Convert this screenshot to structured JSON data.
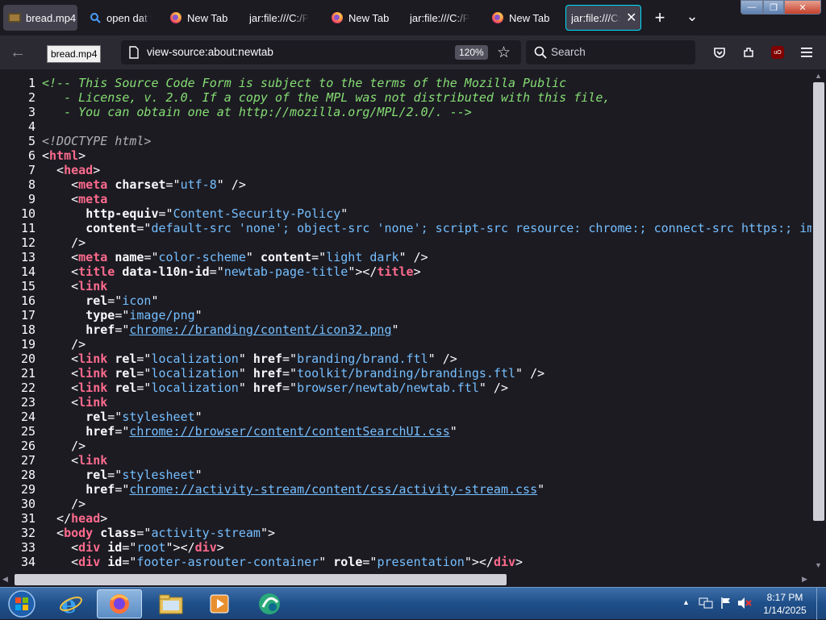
{
  "tabs": [
    {
      "label": "bread.mp4",
      "icon": "video-icon"
    },
    {
      "label": "open dat f",
      "icon": "search-icon"
    },
    {
      "label": "New Tab",
      "icon": "firefox-icon"
    },
    {
      "label": "jar:file:///C:/P",
      "icon": "none"
    },
    {
      "label": "New Tab",
      "icon": "firefox-icon"
    },
    {
      "label": "jar:file:///C:/P",
      "icon": "none"
    },
    {
      "label": "New Tab",
      "icon": "firefox-icon"
    },
    {
      "label": "jar:file:///C:",
      "icon": "none",
      "selected": true
    }
  ],
  "new_tab_symbol": "+",
  "tab_list_symbol": "⌄",
  "window_controls": {
    "minimize": "—",
    "restore": "❐",
    "close": "✕"
  },
  "nav": {
    "back_symbol": "←",
    "tooltip": "bread.mp4",
    "url": "view-source:about:newtab",
    "zoom": "120%",
    "search_placeholder": "Search"
  },
  "source_lines": [
    {
      "n": "1",
      "segs": [
        {
          "c": "c",
          "t": "<!-- This Source Code Form is subject to the terms of the Mozilla Public"
        }
      ]
    },
    {
      "n": "2",
      "segs": [
        {
          "c": "c",
          "t": "   - License, v. 2.0. If a copy of the MPL was not distributed with this file,"
        }
      ]
    },
    {
      "n": "3",
      "segs": [
        {
          "c": "c",
          "t": "   - You can obtain one at http://mozilla.org/MPL/2.0/. -->"
        }
      ]
    },
    {
      "n": "4",
      "segs": []
    },
    {
      "n": "5",
      "segs": [
        {
          "c": "dt",
          "t": "<!DOCTYPE html>"
        }
      ]
    },
    {
      "n": "6",
      "segs": [
        {
          "c": "p",
          "t": "<"
        },
        {
          "c": "tn",
          "t": "html"
        },
        {
          "c": "p",
          "t": ">"
        }
      ]
    },
    {
      "n": "7",
      "segs": [
        {
          "c": "p",
          "t": "  <"
        },
        {
          "c": "tn",
          "t": "head"
        },
        {
          "c": "p",
          "t": ">"
        }
      ]
    },
    {
      "n": "8",
      "segs": [
        {
          "c": "p",
          "t": "    <"
        },
        {
          "c": "tn",
          "t": "meta"
        },
        {
          "c": "p",
          "t": " "
        },
        {
          "c": "a",
          "t": "charset"
        },
        {
          "c": "p",
          "t": "=\""
        },
        {
          "c": "v",
          "t": "utf-8"
        },
        {
          "c": "p",
          "t": "\" />"
        }
      ]
    },
    {
      "n": "9",
      "segs": [
        {
          "c": "p",
          "t": "    <"
        },
        {
          "c": "tn",
          "t": "meta"
        }
      ]
    },
    {
      "n": "10",
      "segs": [
        {
          "c": "p",
          "t": "      "
        },
        {
          "c": "a",
          "t": "http-equiv"
        },
        {
          "c": "p",
          "t": "=\""
        },
        {
          "c": "v",
          "t": "Content-Security-Policy"
        },
        {
          "c": "p",
          "t": "\""
        }
      ]
    },
    {
      "n": "11",
      "segs": [
        {
          "c": "p",
          "t": "      "
        },
        {
          "c": "a",
          "t": "content"
        },
        {
          "c": "p",
          "t": "=\""
        },
        {
          "c": "v",
          "t": "default-src 'none'; object-src 'none'; script-src resource: chrome:; connect-src https:; img-src"
        }
      ]
    },
    {
      "n": "12",
      "segs": [
        {
          "c": "p",
          "t": "    />"
        }
      ]
    },
    {
      "n": "13",
      "segs": [
        {
          "c": "p",
          "t": "    <"
        },
        {
          "c": "tn",
          "t": "meta"
        },
        {
          "c": "p",
          "t": " "
        },
        {
          "c": "a",
          "t": "name"
        },
        {
          "c": "p",
          "t": "=\""
        },
        {
          "c": "v",
          "t": "color-scheme"
        },
        {
          "c": "p",
          "t": "\" "
        },
        {
          "c": "a",
          "t": "content"
        },
        {
          "c": "p",
          "t": "=\""
        },
        {
          "c": "v",
          "t": "light dark"
        },
        {
          "c": "p",
          "t": "\" />"
        }
      ]
    },
    {
      "n": "14",
      "segs": [
        {
          "c": "p",
          "t": "    <"
        },
        {
          "c": "tn",
          "t": "title"
        },
        {
          "c": "p",
          "t": " "
        },
        {
          "c": "a",
          "t": "data-l10n-id"
        },
        {
          "c": "p",
          "t": "=\""
        },
        {
          "c": "v",
          "t": "newtab-page-title"
        },
        {
          "c": "p",
          "t": "\"></"
        },
        {
          "c": "tn",
          "t": "title"
        },
        {
          "c": "p",
          "t": ">"
        }
      ]
    },
    {
      "n": "15",
      "segs": [
        {
          "c": "p",
          "t": "    <"
        },
        {
          "c": "tn",
          "t": "link"
        }
      ]
    },
    {
      "n": "16",
      "segs": [
        {
          "c": "p",
          "t": "      "
        },
        {
          "c": "a",
          "t": "rel"
        },
        {
          "c": "p",
          "t": "=\""
        },
        {
          "c": "v",
          "t": "icon"
        },
        {
          "c": "p",
          "t": "\""
        }
      ]
    },
    {
      "n": "17",
      "segs": [
        {
          "c": "p",
          "t": "      "
        },
        {
          "c": "a",
          "t": "type"
        },
        {
          "c": "p",
          "t": "=\""
        },
        {
          "c": "v",
          "t": "image/png"
        },
        {
          "c": "p",
          "t": "\""
        }
      ]
    },
    {
      "n": "18",
      "segs": [
        {
          "c": "p",
          "t": "      "
        },
        {
          "c": "a",
          "t": "href"
        },
        {
          "c": "p",
          "t": "=\""
        },
        {
          "c": "u",
          "t": "chrome://branding/content/icon32.png"
        },
        {
          "c": "p",
          "t": "\""
        }
      ]
    },
    {
      "n": "19",
      "segs": [
        {
          "c": "p",
          "t": "    />"
        }
      ]
    },
    {
      "n": "20",
      "segs": [
        {
          "c": "p",
          "t": "    <"
        },
        {
          "c": "tn",
          "t": "link"
        },
        {
          "c": "p",
          "t": " "
        },
        {
          "c": "a",
          "t": "rel"
        },
        {
          "c": "p",
          "t": "=\""
        },
        {
          "c": "v",
          "t": "localization"
        },
        {
          "c": "p",
          "t": "\" "
        },
        {
          "c": "a",
          "t": "href"
        },
        {
          "c": "p",
          "t": "=\""
        },
        {
          "c": "v",
          "t": "branding/brand.ftl"
        },
        {
          "c": "p",
          "t": "\" />"
        }
      ]
    },
    {
      "n": "21",
      "segs": [
        {
          "c": "p",
          "t": "    <"
        },
        {
          "c": "tn",
          "t": "link"
        },
        {
          "c": "p",
          "t": " "
        },
        {
          "c": "a",
          "t": "rel"
        },
        {
          "c": "p",
          "t": "=\""
        },
        {
          "c": "v",
          "t": "localization"
        },
        {
          "c": "p",
          "t": "\" "
        },
        {
          "c": "a",
          "t": "href"
        },
        {
          "c": "p",
          "t": "=\""
        },
        {
          "c": "v",
          "t": "toolkit/branding/brandings.ftl"
        },
        {
          "c": "p",
          "t": "\" />"
        }
      ]
    },
    {
      "n": "22",
      "segs": [
        {
          "c": "p",
          "t": "    <"
        },
        {
          "c": "tn",
          "t": "link"
        },
        {
          "c": "p",
          "t": " "
        },
        {
          "c": "a",
          "t": "rel"
        },
        {
          "c": "p",
          "t": "=\""
        },
        {
          "c": "v",
          "t": "localization"
        },
        {
          "c": "p",
          "t": "\" "
        },
        {
          "c": "a",
          "t": "href"
        },
        {
          "c": "p",
          "t": "=\""
        },
        {
          "c": "v",
          "t": "browser/newtab/newtab.ftl"
        },
        {
          "c": "p",
          "t": "\" />"
        }
      ]
    },
    {
      "n": "23",
      "segs": [
        {
          "c": "p",
          "t": "    <"
        },
        {
          "c": "tn",
          "t": "link"
        }
      ]
    },
    {
      "n": "24",
      "segs": [
        {
          "c": "p",
          "t": "      "
        },
        {
          "c": "a",
          "t": "rel"
        },
        {
          "c": "p",
          "t": "=\""
        },
        {
          "c": "v",
          "t": "stylesheet"
        },
        {
          "c": "p",
          "t": "\""
        }
      ]
    },
    {
      "n": "25",
      "segs": [
        {
          "c": "p",
          "t": "      "
        },
        {
          "c": "a",
          "t": "href"
        },
        {
          "c": "p",
          "t": "=\""
        },
        {
          "c": "u",
          "t": "chrome://browser/content/contentSearchUI.css"
        },
        {
          "c": "p",
          "t": "\""
        }
      ]
    },
    {
      "n": "26",
      "segs": [
        {
          "c": "p",
          "t": "    />"
        }
      ]
    },
    {
      "n": "27",
      "segs": [
        {
          "c": "p",
          "t": "    <"
        },
        {
          "c": "tn",
          "t": "link"
        }
      ]
    },
    {
      "n": "28",
      "segs": [
        {
          "c": "p",
          "t": "      "
        },
        {
          "c": "a",
          "t": "rel"
        },
        {
          "c": "p",
          "t": "=\""
        },
        {
          "c": "v",
          "t": "stylesheet"
        },
        {
          "c": "p",
          "t": "\""
        }
      ]
    },
    {
      "n": "29",
      "segs": [
        {
          "c": "p",
          "t": "      "
        },
        {
          "c": "a",
          "t": "href"
        },
        {
          "c": "p",
          "t": "=\""
        },
        {
          "c": "u",
          "t": "chrome://activity-stream/content/css/activity-stream.css"
        },
        {
          "c": "p",
          "t": "\""
        }
      ]
    },
    {
      "n": "30",
      "segs": [
        {
          "c": "p",
          "t": "    />"
        }
      ]
    },
    {
      "n": "31",
      "segs": [
        {
          "c": "p",
          "t": "  </"
        },
        {
          "c": "tn",
          "t": "head"
        },
        {
          "c": "p",
          "t": ">"
        }
      ]
    },
    {
      "n": "32",
      "segs": [
        {
          "c": "p",
          "t": "  <"
        },
        {
          "c": "tn",
          "t": "body"
        },
        {
          "c": "p",
          "t": " "
        },
        {
          "c": "a",
          "t": "class"
        },
        {
          "c": "p",
          "t": "=\""
        },
        {
          "c": "v",
          "t": "activity-stream"
        },
        {
          "c": "p",
          "t": "\">"
        }
      ]
    },
    {
      "n": "33",
      "segs": [
        {
          "c": "p",
          "t": "    <"
        },
        {
          "c": "tn",
          "t": "div"
        },
        {
          "c": "p",
          "t": " "
        },
        {
          "c": "a",
          "t": "id"
        },
        {
          "c": "p",
          "t": "=\""
        },
        {
          "c": "v",
          "t": "root"
        },
        {
          "c": "p",
          "t": "\"></"
        },
        {
          "c": "tn",
          "t": "div"
        },
        {
          "c": "p",
          "t": ">"
        }
      ]
    },
    {
      "n": "34",
      "segs": [
        {
          "c": "p",
          "t": "    <"
        },
        {
          "c": "tn",
          "t": "div"
        },
        {
          "c": "p",
          "t": " "
        },
        {
          "c": "a",
          "t": "id"
        },
        {
          "c": "p",
          "t": "=\""
        },
        {
          "c": "v",
          "t": "footer-asrouter-container"
        },
        {
          "c": "p",
          "t": "\" "
        },
        {
          "c": "a",
          "t": "role"
        },
        {
          "c": "p",
          "t": "=\""
        },
        {
          "c": "v",
          "t": "presentation"
        },
        {
          "c": "p",
          "t": "\"></"
        },
        {
          "c": "tn",
          "t": "div"
        },
        {
          "c": "p",
          "t": ">"
        }
      ]
    }
  ],
  "scrollbar": {
    "up": "▲",
    "down": "▼",
    "left": "◀",
    "right": "▶"
  },
  "taskbar": {
    "apps": [
      "start-orb",
      "internet-explorer",
      "firefox",
      "file-explorer",
      "media-player",
      "app-icon"
    ],
    "tray_expand": "▲",
    "time": "8:17 PM",
    "date": "1/14/2025"
  },
  "colors": {
    "selected_tab_border": "#00ddff",
    "comment": "#86de74",
    "tag": "#ff6b8e",
    "value": "#75bfff"
  }
}
